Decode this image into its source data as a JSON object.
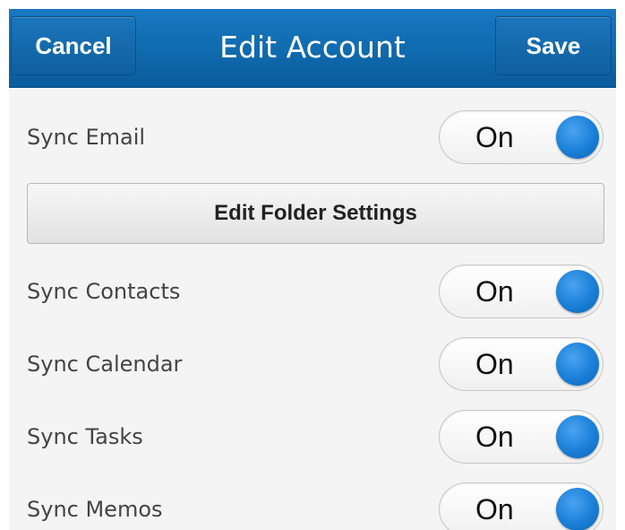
{
  "header": {
    "title": "Edit Account",
    "cancel_label": "Cancel",
    "save_label": "Save"
  },
  "settings": {
    "sync_email": {
      "label": "Sync Email",
      "state": "On"
    },
    "edit_folder_label": "Edit Folder Settings",
    "sync_contacts": {
      "label": "Sync Contacts",
      "state": "On"
    },
    "sync_calendar": {
      "label": "Sync Calendar",
      "state": "On"
    },
    "sync_tasks": {
      "label": "Sync Tasks",
      "state": "On"
    },
    "sync_memos": {
      "label": "Sync Memos",
      "state": "On"
    }
  },
  "colors": {
    "header": "#0f6aae",
    "toggle_knob": "#1a7fd8",
    "background": "#f4f4f4"
  }
}
